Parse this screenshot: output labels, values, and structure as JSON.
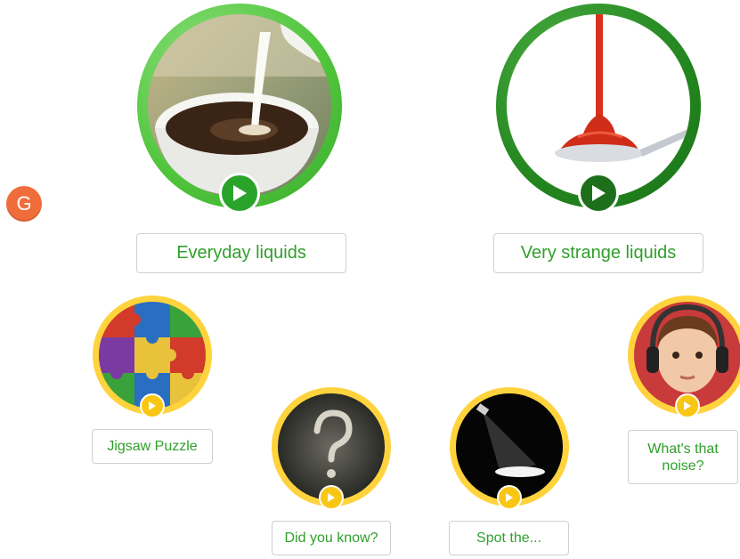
{
  "avatar": {
    "letter": "G",
    "color": "#ef6d3a"
  },
  "topics": [
    {
      "label": "Everyday liquids",
      "ring_color": "#4fc43b",
      "play_color": "#2aa32a",
      "icon": "play-icon"
    },
    {
      "label": "Very strange liquids",
      "ring_color": "#23861f",
      "play_color": "#1e6f1b",
      "icon": "play-icon"
    }
  ],
  "activities": [
    {
      "label": "Jigsaw Puzzle",
      "icon": "puzzle-image"
    },
    {
      "label": "Did you know?",
      "icon": "question-mark-image"
    },
    {
      "label": "Spot the...",
      "icon": "spotlight-image"
    },
    {
      "label": "What's that noise?",
      "icon": "child-headphones-image"
    }
  ],
  "colors": {
    "label_text": "#2fa02a",
    "activity_ring": "#ffd33d",
    "activity_play": "#f9c613"
  }
}
